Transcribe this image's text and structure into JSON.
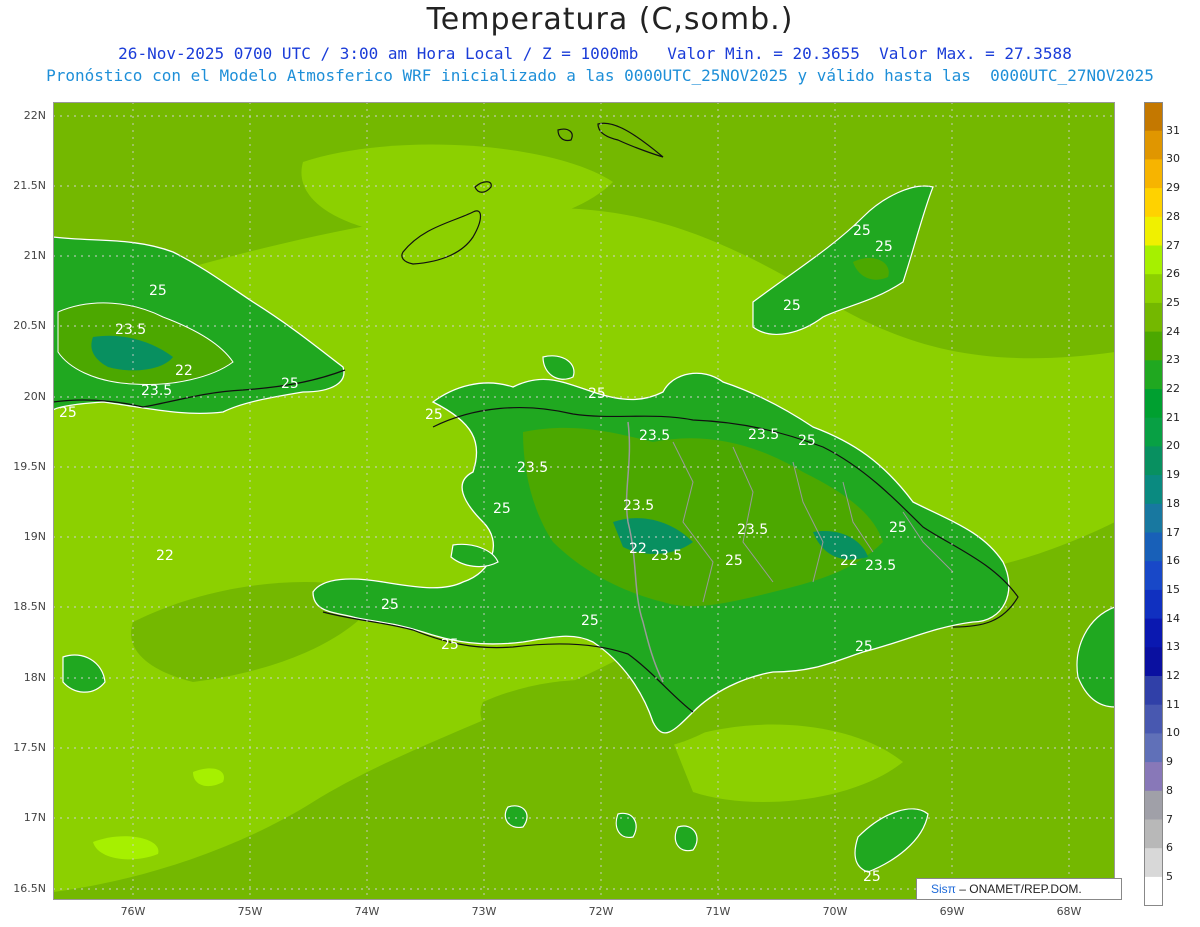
{
  "header": {
    "title": "Temperatura (C,somb.)",
    "line2": "26-Nov-2025 0700 UTC / 3:00 am Hora Local / Z = 1000mb   Valor Min. = 20.3655  Valor Max. = 27.3588",
    "line3": "Pronóstico con el Modelo Atmosferico WRF inicializado a las 0000UTC_25NOV2025 y válido hasta las  0000UTC_27NOV2025"
  },
  "axes": {
    "lat_labels": [
      "22N",
      "21.5N",
      "21N",
      "20.5N",
      "20N",
      "19.5N",
      "19N",
      "18.5N",
      "18N",
      "17.5N",
      "17N",
      "16.5N"
    ],
    "lon_labels": [
      "76W",
      "75W",
      "74W",
      "73W",
      "72W",
      "71W",
      "70W",
      "69W",
      "68W"
    ]
  },
  "contour_labels": [
    "25",
    "23.5",
    "22",
    "25",
    "25",
    "23.5",
    "22",
    "23.5",
    "25",
    "23.5",
    "25",
    "23.5",
    "23.5",
    "22",
    "23.5",
    "23.5",
    "22",
    "23.5",
    "25",
    "25",
    "25",
    "25",
    "25",
    "25",
    "25",
    "25",
    "25",
    "25",
    "25",
    "25"
  ],
  "colorbar": {
    "labels": [
      "31",
      "30",
      "29",
      "28",
      "27",
      "26",
      "25",
      "24",
      "23",
      "22",
      "21",
      "20",
      "19",
      "18",
      "17",
      "16",
      "15",
      "14",
      "13",
      "12",
      "11",
      "10",
      "9",
      "8",
      "7",
      "6",
      "5"
    ],
    "colors": [
      "#c47800",
      "#e09600",
      "#f7b400",
      "#ffd200",
      "#f0f000",
      "#a6f000",
      "#8cd000",
      "#74b800",
      "#4ca800",
      "#20a820",
      "#00a030",
      "#08a044",
      "#089060",
      "#0a8a80",
      "#1878a0",
      "#1860b8",
      "#1848c8",
      "#1030c0",
      "#0a18b0",
      "#0a10a0",
      "#3040a8",
      "#4858b0",
      "#6070b8",
      "#8878b8",
      "#a0a0a8",
      "#b8b8b8",
      "#d8d8d8",
      "#ffffff"
    ]
  },
  "credit": {
    "sis": "Sis",
    "pi": "π",
    "org": "– ONAMET/REP.DOM."
  }
}
